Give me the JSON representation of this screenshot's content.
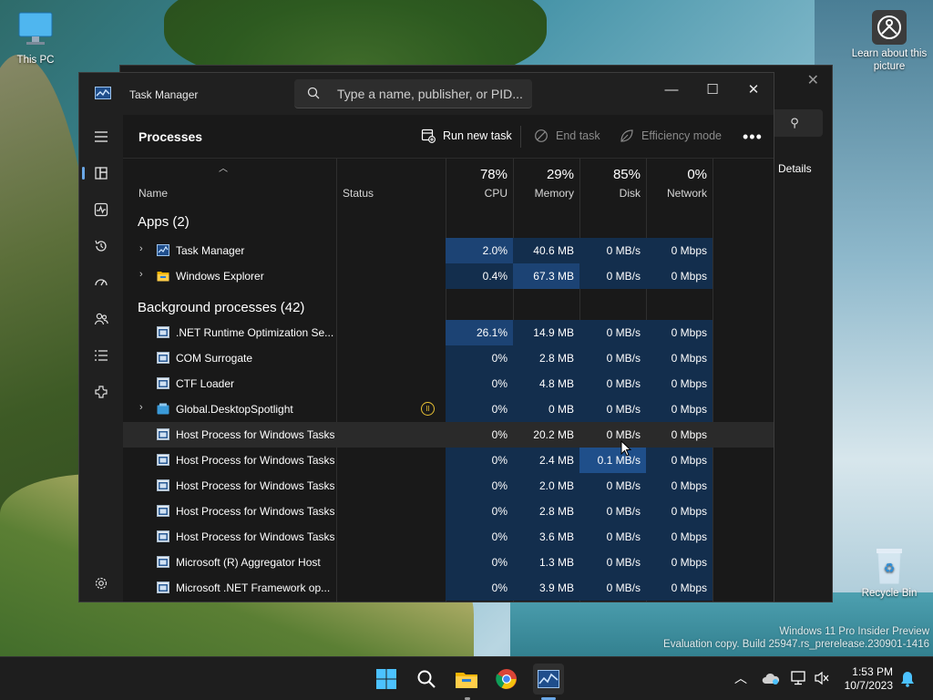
{
  "desktop": {
    "icons": [
      {
        "label": "This PC"
      },
      {
        "label": "Learn about this picture"
      },
      {
        "label": "Recycle Bin"
      }
    ],
    "watermark_line1": "Windows 11 Pro Insider Preview",
    "watermark_line2": "Evaluation copy. Build 25947.rs_prerelease.230901-1416"
  },
  "ghost_window": {
    "details_label": "Details"
  },
  "window": {
    "title": "Task Manager",
    "search_placeholder": "Type a name, publisher, or PID...",
    "minimize": "—",
    "maximize": "☐",
    "close": "✕"
  },
  "nav": {
    "items": [
      {
        "name": "hamburger-menu-icon"
      },
      {
        "name": "processes-icon"
      },
      {
        "name": "performance-icon"
      },
      {
        "name": "app-history-icon"
      },
      {
        "name": "startup-apps-icon"
      },
      {
        "name": "users-icon"
      },
      {
        "name": "details-icon"
      },
      {
        "name": "services-icon"
      },
      {
        "name": "settings-icon"
      }
    ]
  },
  "commandbar": {
    "title": "Processes",
    "run_new_task": "Run new task",
    "end_task": "End task",
    "efficiency_mode": "Efficiency mode",
    "more": "•••"
  },
  "columns": {
    "name": "Name",
    "status": "Status",
    "cpu_pct": "78%",
    "cpu": "CPU",
    "memory_pct": "29%",
    "memory": "Memory",
    "disk_pct": "85%",
    "disk": "Disk",
    "network_pct": "0%",
    "network": "Network"
  },
  "groups": {
    "apps": "Apps (2)",
    "background": "Background processes (42)"
  },
  "apps": [
    {
      "name": "Task Manager",
      "cpu": "2.0%",
      "memory": "40.6 MB",
      "disk": "0 MB/s",
      "network": "0 Mbps"
    },
    {
      "name": "Windows Explorer",
      "cpu": "0.4%",
      "memory": "67.3 MB",
      "disk": "0 MB/s",
      "network": "0 Mbps"
    }
  ],
  "background": [
    {
      "name": ".NET Runtime Optimization Se...",
      "cpu": "26.1%",
      "memory": "14.9 MB",
      "disk": "0 MB/s",
      "network": "0 Mbps"
    },
    {
      "name": "COM Surrogate",
      "cpu": "0%",
      "memory": "2.8 MB",
      "disk": "0 MB/s",
      "network": "0 Mbps"
    },
    {
      "name": "CTF Loader",
      "cpu": "0%",
      "memory": "4.8 MB",
      "disk": "0 MB/s",
      "network": "0 Mbps"
    },
    {
      "name": "Global.DesktopSpotlight",
      "cpu": "0%",
      "memory": "0 MB",
      "disk": "0 MB/s",
      "network": "0 Mbps"
    },
    {
      "name": "Host Process for Windows Tasks",
      "cpu": "0%",
      "memory": "20.2 MB",
      "disk": "0 MB/s",
      "network": "0 Mbps"
    },
    {
      "name": "Host Process for Windows Tasks",
      "cpu": "0%",
      "memory": "2.4 MB",
      "disk": "0.1 MB/s",
      "network": "0 Mbps"
    },
    {
      "name": "Host Process for Windows Tasks",
      "cpu": "0%",
      "memory": "2.0 MB",
      "disk": "0 MB/s",
      "network": "0 Mbps"
    },
    {
      "name": "Host Process for Windows Tasks",
      "cpu": "0%",
      "memory": "2.8 MB",
      "disk": "0 MB/s",
      "network": "0 Mbps"
    },
    {
      "name": "Host Process for Windows Tasks",
      "cpu": "0%",
      "memory": "3.6 MB",
      "disk": "0 MB/s",
      "network": "0 Mbps"
    },
    {
      "name": "Microsoft (R) Aggregator Host",
      "cpu": "0%",
      "memory": "1.3 MB",
      "disk": "0 MB/s",
      "network": "0 Mbps"
    },
    {
      "name": "Microsoft .NET Framework op...",
      "cpu": "0%",
      "memory": "3.9 MB",
      "disk": "0 MB/s",
      "network": "0 Mbps"
    }
  ],
  "taskbar": {
    "time": "1:53 PM",
    "date": "10/7/2023"
  },
  "colors": {
    "accent": "#6aa7e6",
    "heat_low": "#132e4d",
    "heat_mid": "#1c4374"
  }
}
